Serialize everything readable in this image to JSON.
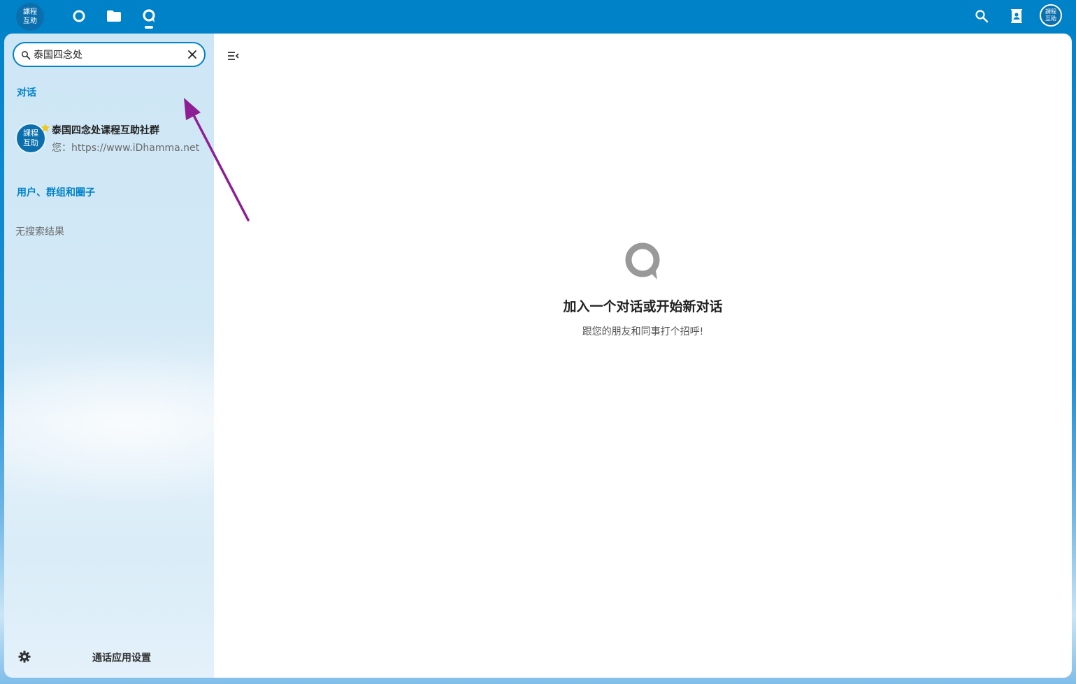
{
  "header": {
    "logo_line1": "課程",
    "logo_line2": "互助",
    "apps": [
      {
        "icon": "dashboard-circle-icon",
        "active": false
      },
      {
        "icon": "folder-icon",
        "active": false
      },
      {
        "icon": "talk-icon",
        "active": true
      }
    ],
    "right_icons": [
      "search-icon",
      "contacts-icon"
    ],
    "user_line1": "課程",
    "user_line2": "互助"
  },
  "sidebar": {
    "search": {
      "value": "泰国四念处",
      "placeholder": ""
    },
    "sections": {
      "conversations": "对话",
      "users_groups": "用户、群组和圈子"
    },
    "conversation": {
      "avatar_line1": "課程",
      "avatar_line2": "互助",
      "favorite": true,
      "name": "泰国四念处课程互助社群",
      "last_message": "您：https://www.iDhamma.net"
    },
    "no_results": "无搜索结果",
    "settings_label": "通话应用设置"
  },
  "main": {
    "empty_title": "加入一个对话或开始新对话",
    "empty_subtitle": "跟您的朋友和同事打个招呼!"
  },
  "colors": {
    "brand": "#0082c9",
    "annotation_arrow": "#8e1e94",
    "star": "#f5c518"
  }
}
